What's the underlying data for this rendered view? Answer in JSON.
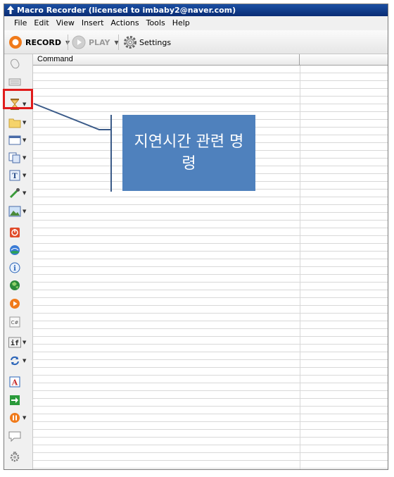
{
  "window": {
    "title": "Macro Recorder (licensed to imbaby2@naver.com)"
  },
  "menubar": {
    "items": [
      "File",
      "Edit",
      "View",
      "Insert",
      "Actions",
      "Tools",
      "Help"
    ]
  },
  "toolbar": {
    "record_label": "RECORD",
    "play_label": "PLAY",
    "settings_label": "Settings"
  },
  "grid": {
    "columns": [
      "Command",
      ""
    ]
  },
  "sidebar": {
    "items": [
      {
        "icon": "mouse-icon",
        "dropdown": false
      },
      {
        "icon": "keyboard-icon",
        "dropdown": false
      },
      {
        "icon": "hourglass-icon",
        "dropdown": true
      },
      {
        "icon": "folder-icon",
        "dropdown": true
      },
      {
        "icon": "window-icon",
        "dropdown": true
      },
      {
        "icon": "copy-icon",
        "dropdown": true
      },
      {
        "icon": "text-icon",
        "dropdown": true
      },
      {
        "icon": "eyedropper-icon",
        "dropdown": true
      },
      {
        "icon": "image-icon",
        "dropdown": true
      },
      {
        "icon": "shutdown-icon",
        "dropdown": false
      },
      {
        "icon": "web-icon",
        "dropdown": false
      },
      {
        "icon": "info-icon",
        "dropdown": false
      },
      {
        "icon": "globe-icon",
        "dropdown": false
      },
      {
        "icon": "play-macro-icon",
        "dropdown": false
      },
      {
        "icon": "csharp-icon",
        "dropdown": false
      },
      {
        "icon": "if-icon",
        "dropdown": true
      },
      {
        "icon": "loop-icon",
        "dropdown": true
      },
      {
        "icon": "label-icon",
        "dropdown": false
      },
      {
        "icon": "goto-icon",
        "dropdown": false
      },
      {
        "icon": "pause-icon",
        "dropdown": true
      },
      {
        "icon": "comment-icon",
        "dropdown": false
      },
      {
        "icon": "settings-gear-icon",
        "dropdown": false
      }
    ]
  },
  "annotation": {
    "text": "지연시간 관련 명령",
    "color": "#4f81bd",
    "highlight_color": "#e01b1b"
  }
}
